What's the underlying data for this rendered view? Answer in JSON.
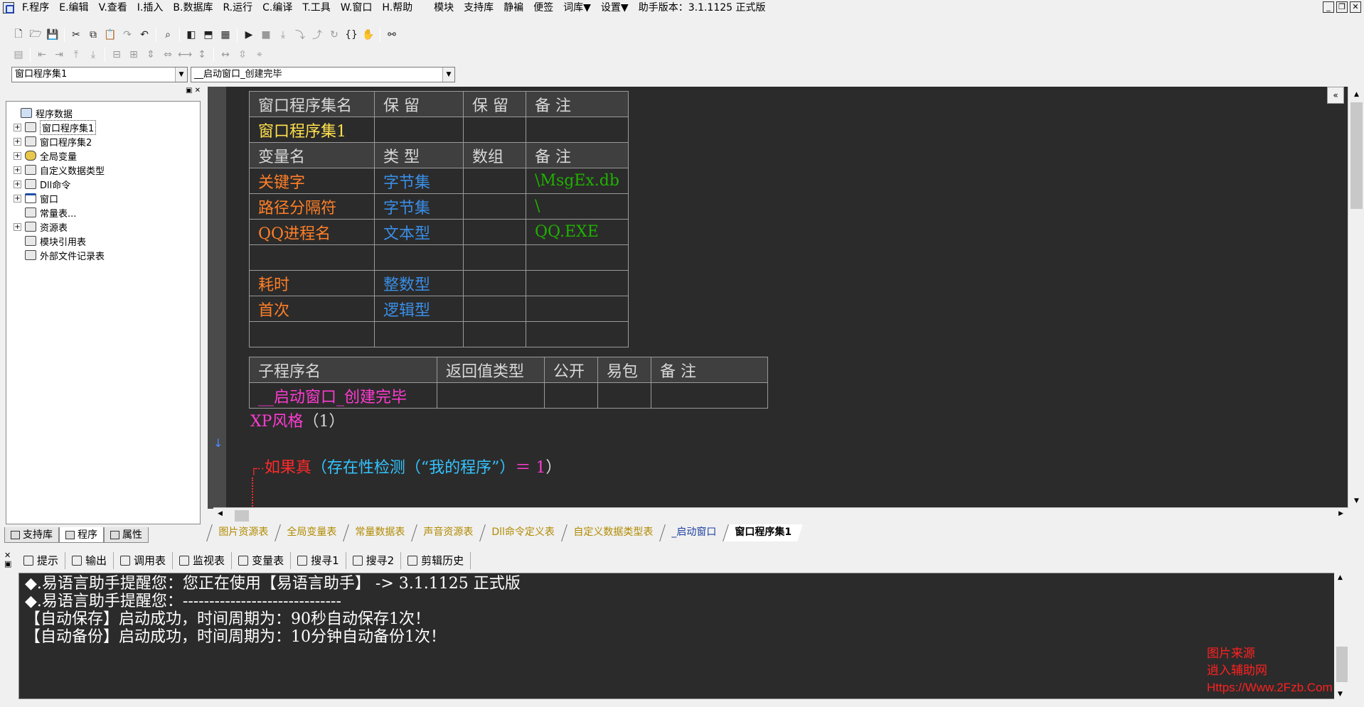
{
  "menu": {
    "items": [
      "F.程序",
      "E.编辑",
      "V.查看",
      "I.插入",
      "B.数据库",
      "R.运行",
      "C.编译",
      "T.工具",
      "W.窗口",
      "H.帮助"
    ],
    "extra_items": [
      "模块",
      "支持库",
      "静褊",
      "便签",
      "词库▼",
      "设置▼"
    ],
    "version_label": "助手版本：3.1.1125 正式版"
  },
  "combos": {
    "assembly": "窗口程序集1",
    "subroutine": "__启动窗口_创建完毕"
  },
  "tree": {
    "items": [
      {
        "label": "程序数据",
        "expand": "",
        "icon": "database-icon"
      },
      {
        "label": "窗口程序集1",
        "expand": "+",
        "icon": "layers-icon"
      },
      {
        "label": "窗口程序集2",
        "expand": "+",
        "icon": "layers-icon"
      },
      {
        "label": "全局变量",
        "expand": "+",
        "icon": "coin-icon"
      },
      {
        "label": "自定义数据类型",
        "expand": "+",
        "icon": "types-icon"
      },
      {
        "label": "Dll命令",
        "expand": "+",
        "icon": "dll-icon"
      },
      {
        "label": "窗口",
        "expand": "+",
        "icon": "window-icon"
      },
      {
        "label": "常量表...",
        "expand": "",
        "icon": "constants-icon"
      },
      {
        "label": "资源表",
        "expand": "+",
        "icon": "resources-icon"
      },
      {
        "label": "模块引用表",
        "expand": "",
        "icon": "module-icon"
      },
      {
        "label": "外部文件记录表",
        "expand": "",
        "icon": "file-icon"
      }
    ]
  },
  "left_tabs": [
    "支持库",
    "程序",
    "属性"
  ],
  "assembly_table": {
    "header": [
      "窗口程序集名",
      "保 留",
      "保 留",
      "备 注"
    ],
    "row": [
      "窗口程序集1",
      "",
      "",
      ""
    ],
    "var_header": [
      "变量名",
      "类 型",
      "数组",
      "备 注"
    ],
    "vars": [
      [
        "关键字",
        "字节集",
        "",
        "\\MsgEx.db"
      ],
      [
        "路径分隔符",
        "字节集",
        "",
        "\\"
      ],
      [
        "QQ进程名",
        "文本型",
        "",
        "QQ.EXE"
      ],
      [
        "",
        "",
        "",
        ""
      ],
      [
        "耗时",
        "整数型",
        "",
        ""
      ],
      [
        "首次",
        "逻辑型",
        "",
        ""
      ],
      [
        "",
        "",
        "",
        ""
      ]
    ]
  },
  "sub_table": {
    "header": [
      "子程序名",
      "返回值类型",
      "公开",
      "易包",
      "备 注"
    ],
    "row": [
      "__启动窗口_创建完毕",
      "",
      "",
      "",
      ""
    ]
  },
  "code": {
    "line1_fn": "XP风格",
    "line1_arg": "（1）",
    "line2_kw": "如果真",
    "line2_paren_open": "（",
    "line2_fn": "存在性检测",
    "line2_str": "（“我的程序”）",
    "line2_eq": "＝ 1",
    "line2_paren_close": "）"
  },
  "editor_tabs": [
    "图片资源表",
    "全局变量表",
    "常量数据表",
    "声音资源表",
    "Dll命令定义表",
    "自定义数据类型表",
    "_启动窗口",
    "窗口程序集1"
  ],
  "bottom_tabs": [
    "提示",
    "输出",
    "调用表",
    "监视表",
    "变量表",
    "搜寻1",
    "搜寻2",
    "剪辑历史"
  ],
  "output": {
    "lines": [
      "◆.易语言助手提醒您：您正在使用【易语言助手】 ->  3.1.1125 正式版",
      "◆.易语言助手提醒您：------------------------------",
      "【自动保存】启动成功，时间周期为：90秒自动保存1次！",
      "【自动备份】启动成功，时间周期为：10分钟自动备份1次！"
    ]
  },
  "watermark": {
    "line1": "图片来源",
    "line2": "逍入辅助网",
    "line3": "Https://Www.2Fzb.Com"
  },
  "colors": {
    "editor_bg": "#2b2b2b",
    "variable_name": "#ff7f27",
    "type_name": "#3a8ee6",
    "comment": "#20b000",
    "assembly_name": "#ffe14d",
    "sub_name": "#ff3bd2"
  }
}
